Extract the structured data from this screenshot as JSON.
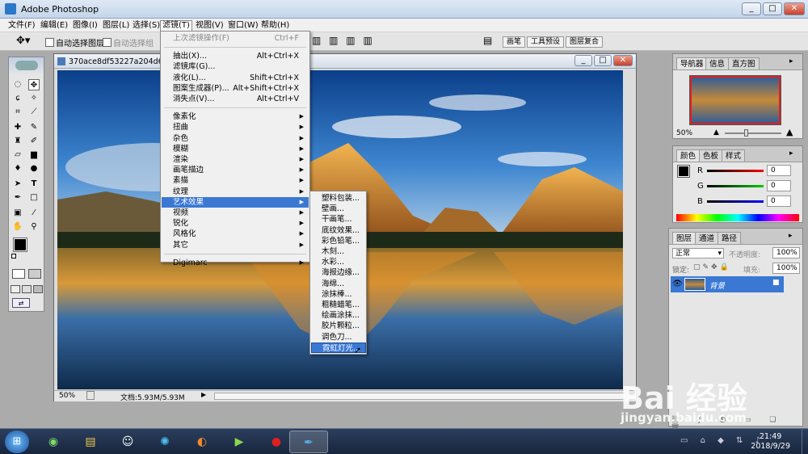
{
  "window": {
    "title": "Adobe Photoshop",
    "minimize": "_",
    "maximize": "□",
    "close": "✕"
  },
  "menubar": [
    "文件(F)",
    "编辑(E)",
    "图像(I)",
    "图层(L)",
    "选择(S)",
    "滤镜(T)",
    "视图(V)",
    "窗口(W)",
    "帮助(H)"
  ],
  "options": {
    "auto_select_layer": "自动选择图层",
    "auto_select_group": "自动选择组",
    "palette_wells": [
      "画笔",
      "工具预设",
      "图层复合"
    ]
  },
  "document": {
    "title": "370ace8df53227a204d64c",
    "zoom": "50%",
    "status": "文档:5.93M/5.93M"
  },
  "filter_menu": {
    "items": [
      {
        "label": "上次滤镜操作(F)",
        "shortcut": "Ctrl+F",
        "disabled": true
      },
      {
        "sep": true
      },
      {
        "label": "抽出(X)...",
        "shortcut": "Alt+Ctrl+X"
      },
      {
        "label": "滤镜库(G)...",
        "shortcut": ""
      },
      {
        "label": "液化(L)...",
        "shortcut": "Shift+Ctrl+X"
      },
      {
        "label": "图案生成器(P)...",
        "shortcut": "Alt+Shift+Ctrl+X"
      },
      {
        "label": "消失点(V)...",
        "shortcut": "Alt+Ctrl+V"
      },
      {
        "sep": true
      },
      {
        "label": "像素化",
        "submenu": true
      },
      {
        "label": "扭曲",
        "submenu": true
      },
      {
        "label": "杂色",
        "submenu": true
      },
      {
        "label": "模糊",
        "submenu": true
      },
      {
        "label": "渲染",
        "submenu": true
      },
      {
        "label": "画笔描边",
        "submenu": true
      },
      {
        "label": "素描",
        "submenu": true
      },
      {
        "label": "纹理",
        "submenu": true
      },
      {
        "label": "艺术效果",
        "submenu": true,
        "highlighted": true
      },
      {
        "label": "视频",
        "submenu": true
      },
      {
        "label": "锐化",
        "submenu": true
      },
      {
        "label": "风格化",
        "submenu": true
      },
      {
        "label": "其它",
        "submenu": true
      },
      {
        "sep": true
      },
      {
        "label": "Digimarc",
        "submenu": true
      }
    ]
  },
  "artistic_submenu": [
    "塑料包装...",
    "壁画...",
    "干画笔...",
    "底纹效果...",
    "彩色铅笔...",
    "木刻...",
    "水彩...",
    "海报边缘...",
    "海绵...",
    "涂抹棒...",
    "粗糙蜡笔...",
    "绘画涂抹...",
    "胶片颗粒...",
    "调色刀...",
    "霓虹灯光..."
  ],
  "artistic_highlight_index": 14,
  "navigator": {
    "tabs": [
      "导航器",
      "信息",
      "直方图"
    ],
    "zoom": "50%"
  },
  "color": {
    "tabs": [
      "颜色",
      "色板",
      "样式"
    ],
    "channels": [
      {
        "name": "R",
        "value": "0"
      },
      {
        "name": "G",
        "value": "0"
      },
      {
        "name": "B",
        "value": "0"
      }
    ]
  },
  "layers": {
    "tabs": [
      "图层",
      "通道",
      "路径"
    ],
    "blend": "正常",
    "opacity_label": "不透明度:",
    "opacity": "100%",
    "lock_label": "锁定:",
    "fill_label": "填充:",
    "fill": "100%",
    "layer_name": "背景"
  },
  "taskbar": {
    "time": "21:49",
    "date": "2018/9/29"
  },
  "watermark": {
    "text": "Bai  经验",
    "url": "jingyan.baidu.com"
  },
  "colors": {
    "selection": "#3a78d4",
    "taskbar": "#1e2d48"
  }
}
